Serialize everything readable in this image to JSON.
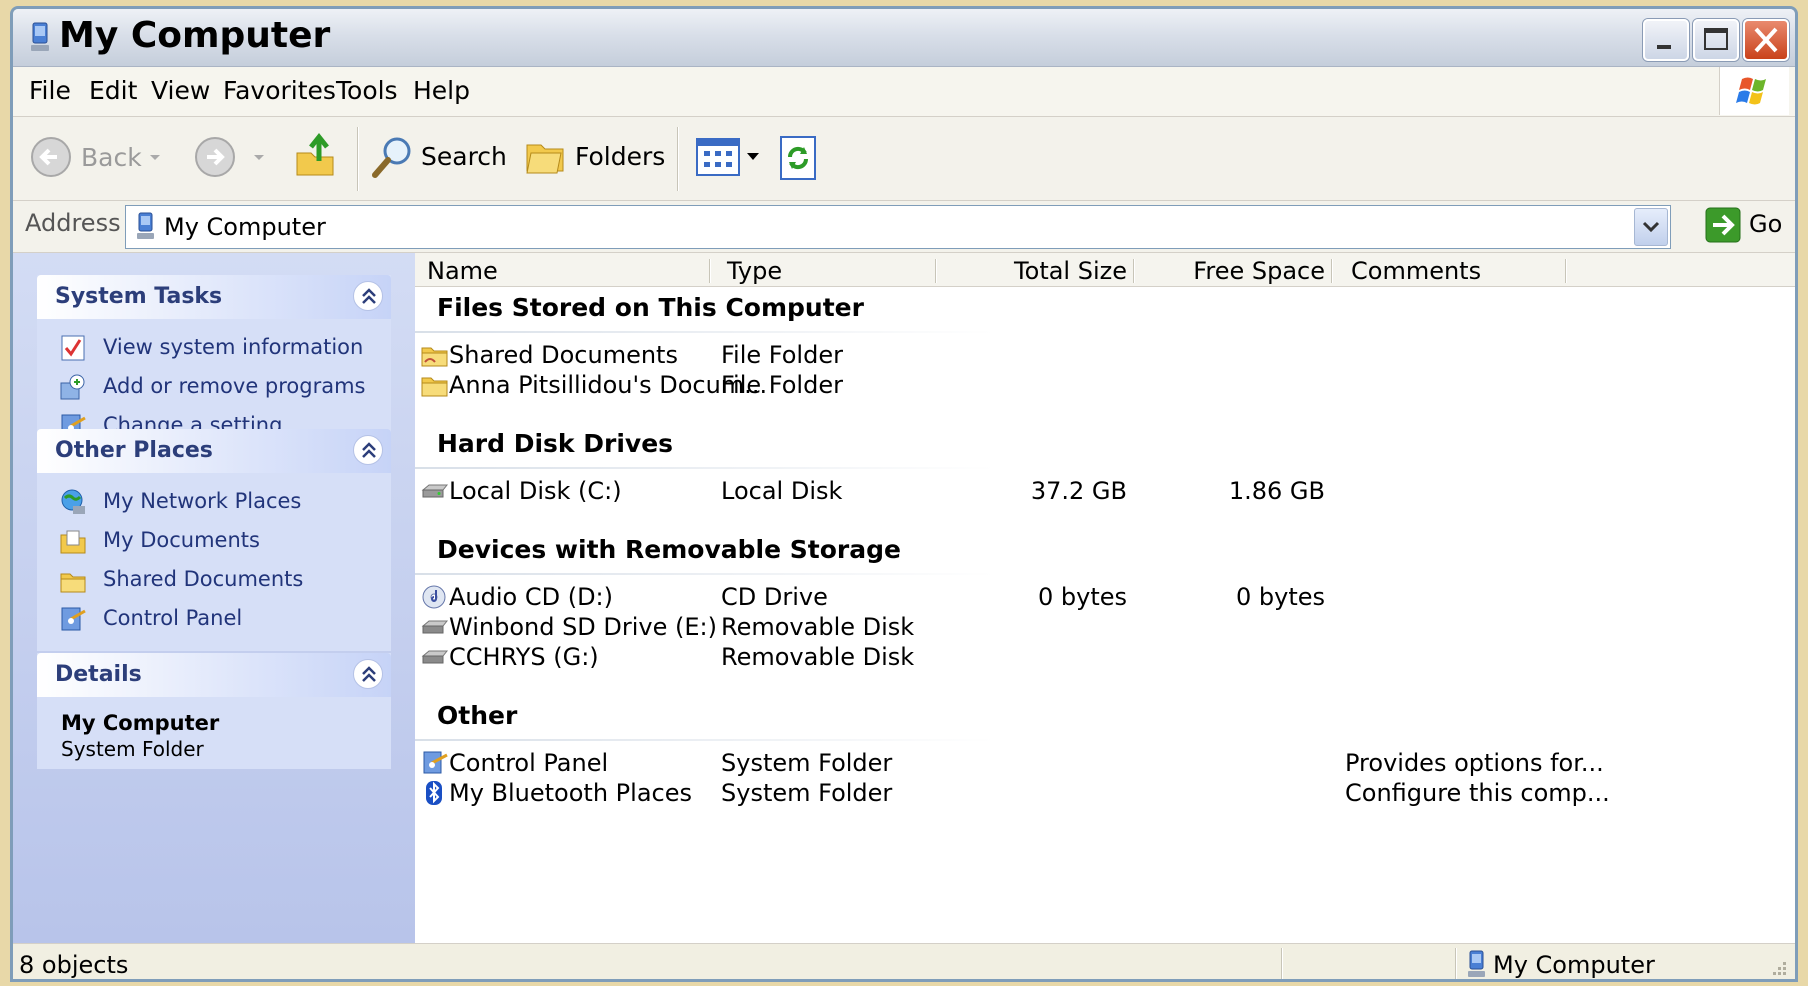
{
  "window": {
    "title": "My Computer"
  },
  "menu": {
    "items": [
      {
        "label": "File"
      },
      {
        "label": "Edit"
      },
      {
        "label": "View"
      },
      {
        "label": "Favorites"
      },
      {
        "label": "Tools"
      },
      {
        "label": "Help"
      }
    ]
  },
  "toolbar": {
    "back_label": "Back",
    "search_label": "Search",
    "folders_label": "Folders"
  },
  "address": {
    "label": "Address",
    "value": "My Computer",
    "go_label": "Go"
  },
  "left_pane": {
    "system_tasks": {
      "title": "System Tasks",
      "items": [
        {
          "label": "View system information",
          "icon": "system-info-icon"
        },
        {
          "label": "Add or remove programs",
          "icon": "add-remove-icon"
        },
        {
          "label": "Change a setting",
          "icon": "control-panel-icon"
        }
      ]
    },
    "other_places": {
      "title": "Other Places",
      "items": [
        {
          "label": "My Network Places",
          "icon": "network-places-icon"
        },
        {
          "label": "My Documents",
          "icon": "my-documents-icon"
        },
        {
          "label": "Shared Documents",
          "icon": "folder-icon"
        },
        {
          "label": "Control Panel",
          "icon": "control-panel-icon"
        }
      ]
    },
    "details": {
      "title": "Details",
      "name": "My Computer",
      "type": "System Folder"
    }
  },
  "columns": [
    {
      "label": "Name"
    },
    {
      "label": "Type"
    },
    {
      "label": "Total Size"
    },
    {
      "label": "Free Space"
    },
    {
      "label": "Comments"
    }
  ],
  "groups": [
    {
      "title": "Files Stored on This Computer",
      "rows": [
        {
          "name": "Shared Documents",
          "type": "File Folder",
          "total": "",
          "free": "",
          "comments": "",
          "icon": "shared-folder-icon"
        },
        {
          "name": "Anna Pitsillidou's Docum...",
          "type": "File Folder",
          "total": "",
          "free": "",
          "comments": "",
          "icon": "folder-icon"
        }
      ]
    },
    {
      "title": "Hard Disk Drives",
      "rows": [
        {
          "name": "Local Disk (C:)",
          "type": "Local Disk",
          "total": "37.2 GB",
          "free": "1.86 GB",
          "comments": "",
          "icon": "hard-disk-icon"
        }
      ]
    },
    {
      "title": "Devices with Removable Storage",
      "rows": [
        {
          "name": "Audio CD (D:)",
          "type": "CD Drive",
          "total": "0 bytes",
          "free": "0 bytes",
          "comments": "",
          "icon": "audio-cd-icon"
        },
        {
          "name": "Winbond SD Drive (E:)",
          "type": "Removable Disk",
          "total": "",
          "free": "",
          "comments": "",
          "icon": "removable-disk-icon"
        },
        {
          "name": "CCHRYS (G:)",
          "type": "Removable Disk",
          "total": "",
          "free": "",
          "comments": "",
          "icon": "removable-disk-icon"
        }
      ]
    },
    {
      "title": "Other",
      "rows": [
        {
          "name": "Control Panel",
          "type": "System Folder",
          "total": "",
          "free": "",
          "comments": "Provides options for...",
          "icon": "control-panel-icon"
        },
        {
          "name": "My Bluetooth Places",
          "type": "System Folder",
          "total": "",
          "free": "",
          "comments": "Configure this comp...",
          "icon": "bluetooth-icon"
        }
      ]
    }
  ],
  "status": {
    "objects": "8 objects",
    "location": "My Computer"
  },
  "colors": {
    "panel_title": "#2c3e7a",
    "task_link": "#21347a",
    "go_green": "#3c9a2a",
    "close_red": "#c9421b"
  }
}
